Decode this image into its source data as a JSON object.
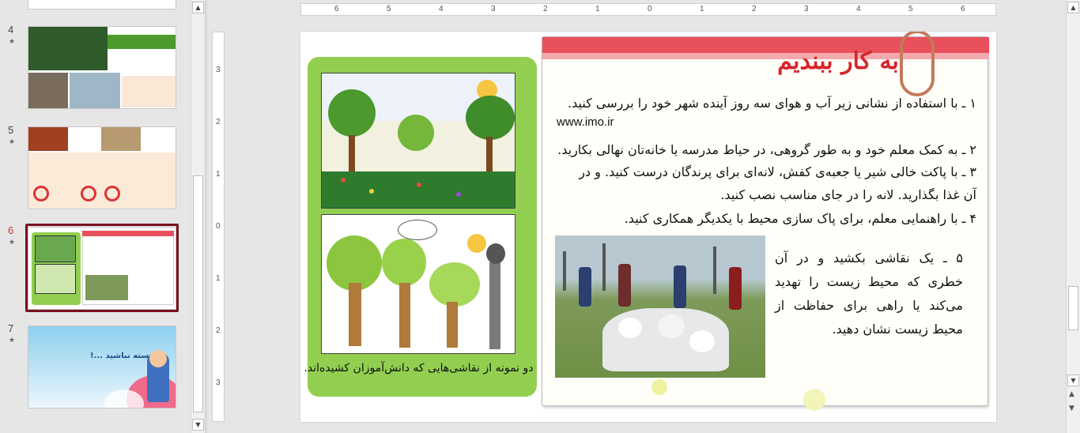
{
  "thumbnails": [
    {
      "number": "4",
      "star": "★",
      "active": false
    },
    {
      "number": "5",
      "star": "★",
      "active": false
    },
    {
      "number": "6",
      "star": "★",
      "active": true
    },
    {
      "number": "7",
      "star": "★",
      "active": false
    }
  ],
  "thumb7_text": "خسته نباشید ...!",
  "ruler_h": [
    "6",
    "5",
    "4",
    "3",
    "2",
    "1",
    "0",
    "1",
    "2",
    "3",
    "4",
    "5",
    "6"
  ],
  "ruler_v": [
    "3",
    "2",
    "1",
    "0",
    "1",
    "2",
    "3"
  ],
  "slide": {
    "title": "به کار ببندیم",
    "item1": "۱ ـ با استفاده از نشانی زیر آب و هوای سه روز آینده شهر خود را بررسی کنید.",
    "url": "www.imo.ir",
    "item2": "۲ ـ به کمک معلم خود و به طور گروهی، در حیاط مدرسه یا خانه‌تان نهالی بکارید.",
    "item3a": "۳ ـ با پاکت خالی شیر یا جعبه‌ی کفش، لانه‌ای برای پرندگان درست کنید. و در",
    "item3b": "آن غذا بگذارید. لانه را در جای مناسب نصب کنید.",
    "item4": "۴ ـ با راهنمایی معلم، برای پاک سازی محیط با یکدیگر همکاری کنید.",
    "item5": "۵ ـ یک نقاشی بکشید و در آن خطری که محیط زیست را تهدید می‌کند یا راهی برای حفاظت از محیط زیست نشان دهید.",
    "caption": "دو نمونه از نقاشی‌هایی که دانش‌آموزان کشیده‌اند."
  },
  "colors": {
    "accent_red": "#d7242a",
    "panel_green": "#92cf50",
    "selection": "#7a1020"
  }
}
